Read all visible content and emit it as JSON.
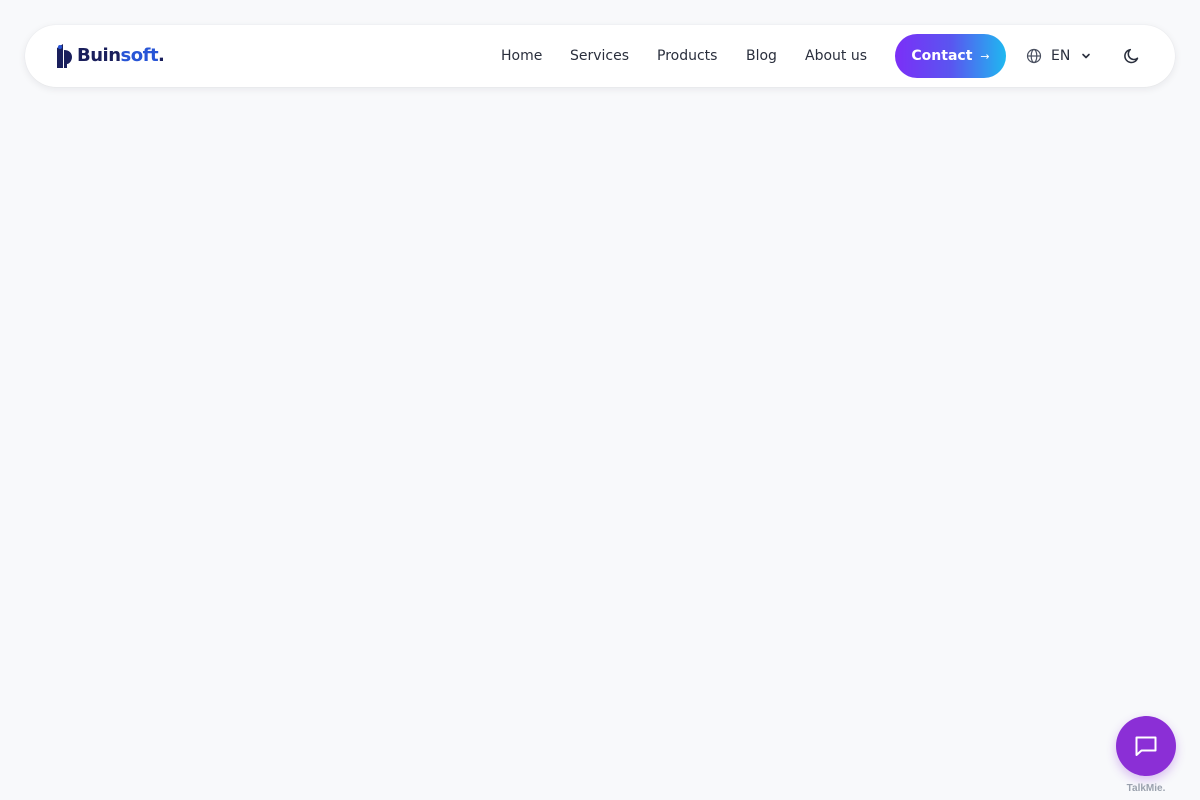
{
  "header": {
    "logo": {
      "brand_dark": "Buin",
      "brand_light": "soft",
      "brand_dot": "."
    },
    "nav": [
      {
        "label": "Home"
      },
      {
        "label": "Services"
      },
      {
        "label": "Products"
      },
      {
        "label": "Blog"
      },
      {
        "label": "About us"
      }
    ],
    "contact_button": {
      "label": "Contact",
      "arrow": "→"
    },
    "language": {
      "label": "EN",
      "icon": "globe-icon"
    },
    "theme_toggle": {
      "icon": "moon-icon"
    }
  },
  "chat_widget": {
    "icon": "chat-bubble-icon",
    "brand": "TalkMie."
  },
  "colors": {
    "background": "#f8f9fb",
    "brand_dark": "#1a1f5c",
    "brand_light": "#2855d6",
    "contact_gradient_start": "#7b2ff7",
    "contact_gradient_end": "#1fb8f0",
    "chat_button": "#8b2fd6"
  }
}
